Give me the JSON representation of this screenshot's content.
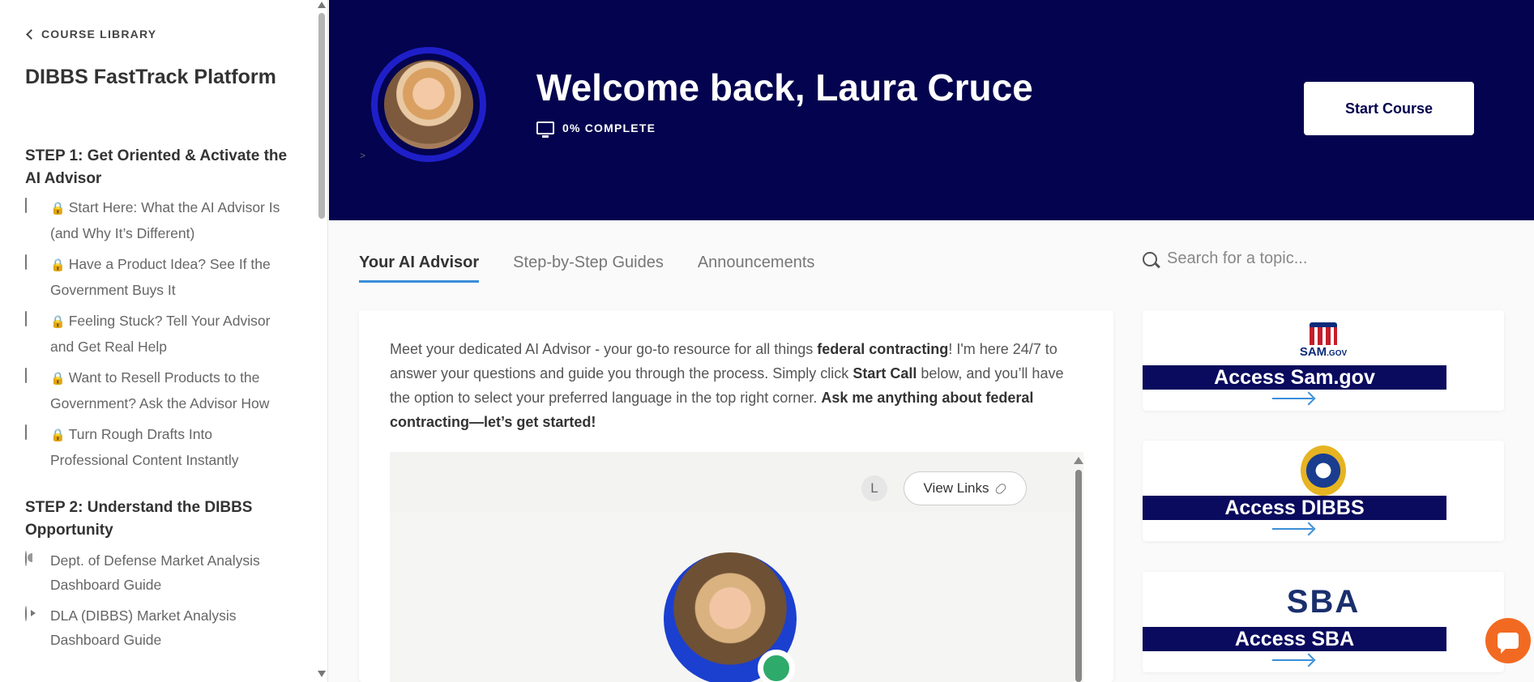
{
  "sidebar": {
    "back_label": "COURSE LIBRARY",
    "course_title": "DIBBS FastTrack Platform",
    "sections": [
      {
        "title": "STEP 1: Get Oriented & Activate the AI Advisor",
        "lessons": [
          {
            "icon": "document-icon",
            "locked": true,
            "label": "Start Here: What the AI Advisor Is (and Why It’s Different)"
          },
          {
            "icon": "document-icon",
            "locked": true,
            "label": "Have a Product Idea? See If the Government Buys It"
          },
          {
            "icon": "document-icon",
            "locked": true,
            "label": "Feeling Stuck? Tell Your Advisor and Get Real Help"
          },
          {
            "icon": "document-icon",
            "locked": true,
            "label": "Want to Resell Products to the Government? Ask the Advisor How"
          },
          {
            "icon": "document-icon",
            "locked": true,
            "label": "Turn Rough Drafts Into Professional Content Instantly"
          }
        ]
      },
      {
        "title": "STEP 2: Understand the DIBBS Opportunity",
        "lessons": [
          {
            "icon": "half-circle-icon",
            "locked": false,
            "label": "Dept. of Defense Market Analysis Dashboard Guide"
          },
          {
            "icon": "play-icon",
            "locked": false,
            "label": "DLA (DIBBS) Market Analysis Dashboard Guide"
          }
        ]
      }
    ]
  },
  "hero": {
    "welcome": "Welcome back, Laura Cruce",
    "progress_text": "0% COMPLETE",
    "start_button": "Start Course",
    "tiny_caret": ">"
  },
  "tabs": [
    {
      "label": "Your AI Advisor",
      "active": true
    },
    {
      "label": "Step-by-Step Guides",
      "active": false
    },
    {
      "label": "Announcements",
      "active": false
    }
  ],
  "search": {
    "placeholder": "Search for a topic..."
  },
  "advisor": {
    "intro_1": "Meet your dedicated AI Advisor - your go-to resource for all things ",
    "intro_bold_1": "federal contracting",
    "intro_2": "! I'm here 24/7 to answer your questions and guide you through the process. Simply click ",
    "intro_bold_2": "Start Call",
    "intro_3": " below, and you’ll have the option to select your preferred language in the top right corner. ",
    "intro_bold_3": "Ask me anything about federal contracting—let’s get started!",
    "user_initial": "L",
    "view_links": "View Links"
  },
  "resources": [
    {
      "logo": "SAM",
      "logo_suffix": ".GOV",
      "label": "Access Sam.gov"
    },
    {
      "logo": "dibbs-seal",
      "label": "Access DIBBS"
    },
    {
      "logo": "SBA",
      "label": "Access SBA"
    }
  ],
  "colors": {
    "hero_bg": "#03034f",
    "ring": "#1f1fc9",
    "tab_underline": "#3a8ed8",
    "resource_bar": "#0a0a5e",
    "chat": "#f26a21",
    "online": "#2eaa6a"
  }
}
